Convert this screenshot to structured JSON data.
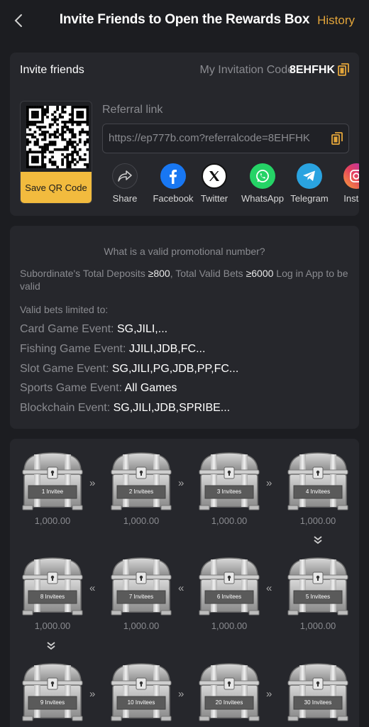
{
  "header": {
    "title": "Invite Friends to Open the Rewards Box",
    "history_label": "History"
  },
  "invite": {
    "label": "Invite friends",
    "code_label": "My Invitation Code",
    "code_value": "8EHFHK",
    "save_qr_label": "Save QR Code",
    "referral_label": "Referral link",
    "referral_url": "https://ep777b.com?referralcode=8EHFHK"
  },
  "share": [
    {
      "label": "Share",
      "icon": "share-icon",
      "color": "#2a2b30"
    },
    {
      "label": "Facebook",
      "icon": "facebook-icon",
      "color": "#1877f2"
    },
    {
      "label": "Twitter",
      "icon": "twitter-x-icon",
      "color": "#ffffff"
    },
    {
      "label": "WhatsApp",
      "icon": "whatsapp-icon",
      "color": "#25d366"
    },
    {
      "label": "Telegram",
      "icon": "telegram-icon",
      "color": "#2aa3e0"
    },
    {
      "label": "Instag",
      "icon": "instagram-icon",
      "color": "#e4405f"
    }
  ],
  "rules": {
    "question": "What is a valid promotional number?",
    "cond_part1": "Subordinate's Total Deposits ",
    "cond_deposit": "≥800",
    "cond_part2": ", Total Valid Bets ",
    "cond_bets": "≥6000",
    "cond_part3": " Log in App to be valid",
    "valid_bets_label": "Valid bets limited to:",
    "events": [
      {
        "name": "Card Game Event: ",
        "value": "SG,JILI,..."
      },
      {
        "name": "Fishing Game Event: ",
        "value": "JJILI,JDB,FC..."
      },
      {
        "name": "Slot Game Event: ",
        "value": "SG,JILI,PG,JDB,PP,FC..."
      },
      {
        "name": "Sports Game Event: ",
        "value": "All Games"
      },
      {
        "name": "Blockchain Event: ",
        "value": "SG,JILI,JDB,SPRIBE..."
      }
    ]
  },
  "chests": [
    {
      "label": "1 Invitee",
      "reward": "1,000.00"
    },
    {
      "label": "2 Invitees",
      "reward": "1,000.00"
    },
    {
      "label": "3 Invitees",
      "reward": "1,000.00"
    },
    {
      "label": "4 Invitees",
      "reward": "1,000.00"
    },
    {
      "label": "8 Invitees",
      "reward": "1,000.00"
    },
    {
      "label": "7 Invitees",
      "reward": "1,000.00"
    },
    {
      "label": "6 Invitees",
      "reward": "1,000.00"
    },
    {
      "label": "5 Invitees",
      "reward": "1,000.00"
    },
    {
      "label": "9 Invitees",
      "reward": ""
    },
    {
      "label": "10 Invitees",
      "reward": ""
    },
    {
      "label": "20 Invitees",
      "reward": ""
    },
    {
      "label": "30 Invitees",
      "reward": ""
    }
  ],
  "colors": {
    "accent": "#e3a53a",
    "save_button": "#f2bb3e",
    "card_bg": "#26272c",
    "page_bg": "#1c1d21"
  }
}
